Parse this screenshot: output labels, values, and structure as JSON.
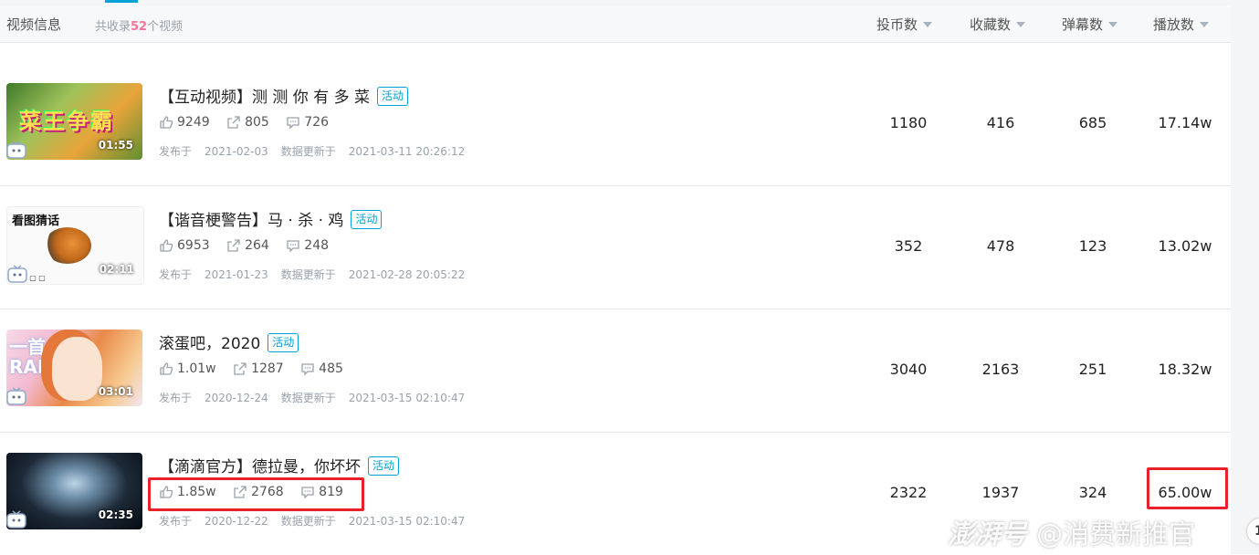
{
  "header": {
    "title": "视频信息",
    "count_prefix": "共收录",
    "count": "52",
    "count_suffix": "个视频",
    "columns": [
      "投币数",
      "收藏数",
      "弹幕数",
      "播放数"
    ]
  },
  "videos": [
    {
      "title": "【互动视频】测 测 你 有 多 菜",
      "tag": "活动",
      "duration": "01:55",
      "thumb_text": "菜王争霸",
      "likes": "9249",
      "shares": "805",
      "comments": "726",
      "published_label": "发布于",
      "published": "2021-02-03",
      "updated_label": "数据更新于",
      "updated": "2021-03-11 20:26:12",
      "coins": "1180",
      "favorites": "416",
      "danmaku": "685",
      "plays": "17.14w"
    },
    {
      "title": "【谐音梗警告】马 · 杀 · 鸡",
      "tag": "活动",
      "duration": "02:11",
      "thumb_text": "看图猜话",
      "likes": "6953",
      "shares": "264",
      "comments": "248",
      "published_label": "发布于",
      "published": "2021-01-23",
      "updated_label": "数据更新于",
      "updated": "2021-02-28 20:05:22",
      "coins": "352",
      "favorites": "478",
      "danmaku": "123",
      "plays": "13.02w"
    },
    {
      "title": "滚蛋吧，2020",
      "tag": "活动",
      "duration": "03:01",
      "thumb_text": "一首 RAP",
      "likes": "1.01w",
      "shares": "1287",
      "comments": "485",
      "published_label": "发布于",
      "published": "2020-12-24",
      "updated_label": "数据更新于",
      "updated": "2021-03-15 02:10:47",
      "coins": "3040",
      "favorites": "2163",
      "danmaku": "251",
      "plays": "18.32w"
    },
    {
      "title": "【滴滴官方】德拉曼，你坏坏",
      "tag": "活动",
      "duration": "02:35",
      "thumb_text": "",
      "likes": "1.85w",
      "shares": "2768",
      "comments": "819",
      "published_label": "发布于",
      "published": "2020-12-22",
      "updated_label": "数据更新于",
      "updated": "2021-03-15 02:10:47",
      "coins": "2322",
      "favorites": "1937",
      "danmaku": "324",
      "plays": "65.00w"
    }
  ],
  "watermark": {
    "brand": "澎湃号",
    "at_account": "@消费新推官"
  },
  "corner_button": "1",
  "colors": {
    "accent": "#00a1d6",
    "count_highlight": "#fb7299",
    "highlight_box": "#e8212a"
  }
}
